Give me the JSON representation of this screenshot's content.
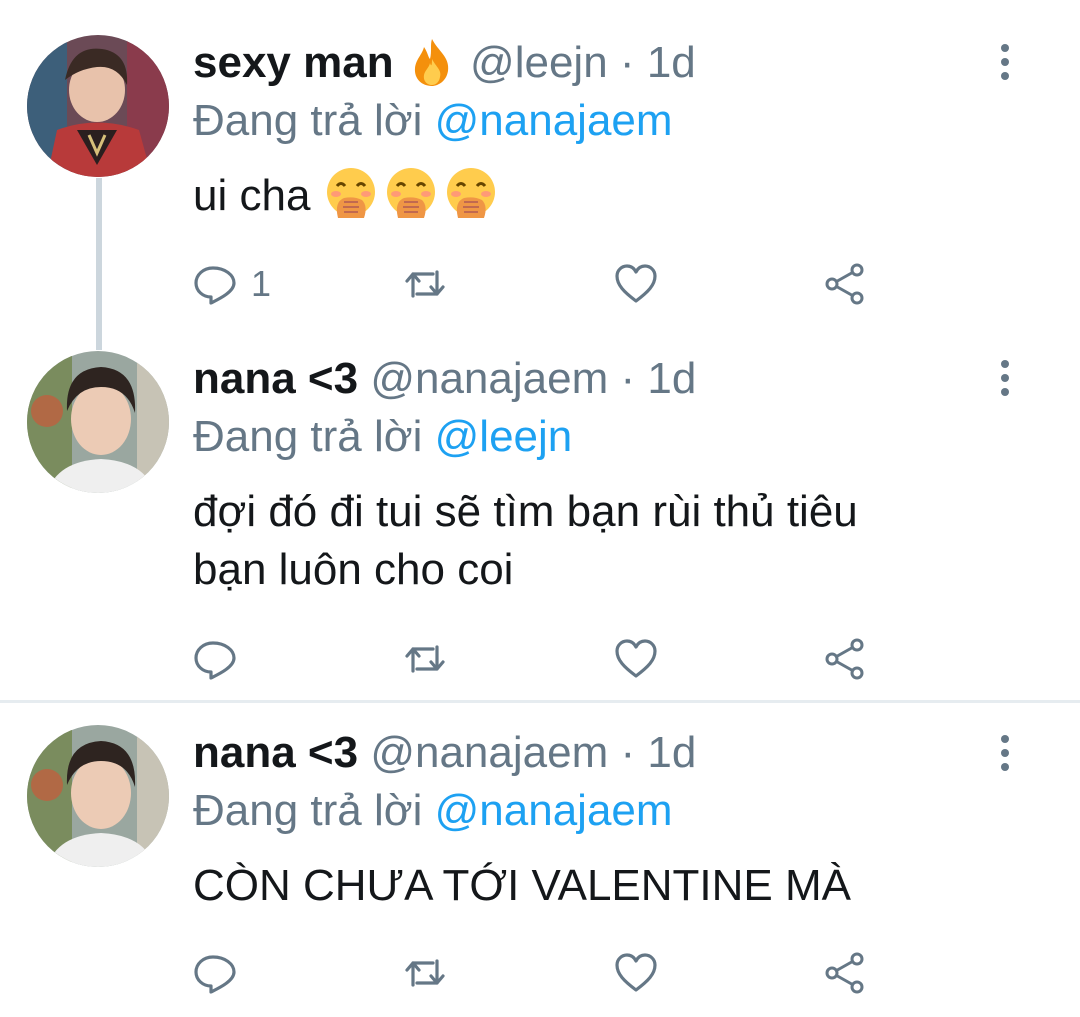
{
  "tweets": [
    {
      "name": "sexy man",
      "name_emoji_icon": "fire-icon",
      "handle": "@leejn",
      "separator": "·",
      "time": "1d",
      "reply_prefix": "Đang trả lời",
      "reply_to": "@nanajaem",
      "text": "ui cha",
      "text_emoji_icons": [
        "hand-over-mouth-emoji-icon",
        "hand-over-mouth-emoji-icon",
        "hand-over-mouth-emoji-icon"
      ],
      "reply_count": "1"
    },
    {
      "name": "nana <3",
      "handle": "@nanajaem",
      "separator": "·",
      "time": "1d",
      "reply_prefix": "Đang trả lời",
      "reply_to": "@leejn",
      "text_line1": "đợi đó đi tui sẽ tìm bạn rùi thủ tiêu",
      "text_line2": "bạn luôn cho coi",
      "reply_count": ""
    },
    {
      "name": "nana <3",
      "handle": "@nanajaem",
      "separator": "·",
      "time": "1d",
      "reply_prefix": "Đang trả lời",
      "reply_to": "@nanajaem",
      "text": "CÒN CHƯA TỚI VALENTINE MÀ",
      "reply_count": ""
    }
  ],
  "icons": {
    "reply": "reply-icon",
    "retweet": "retweet-icon",
    "like": "heart-icon",
    "share": "share-icon",
    "more": "more-vertical-icon"
  },
  "colors": {
    "text": "#14171a",
    "secondary": "#657786",
    "link": "#1da1f2",
    "divider": "#e6ecf0",
    "thread_line": "#ccd6dd"
  }
}
